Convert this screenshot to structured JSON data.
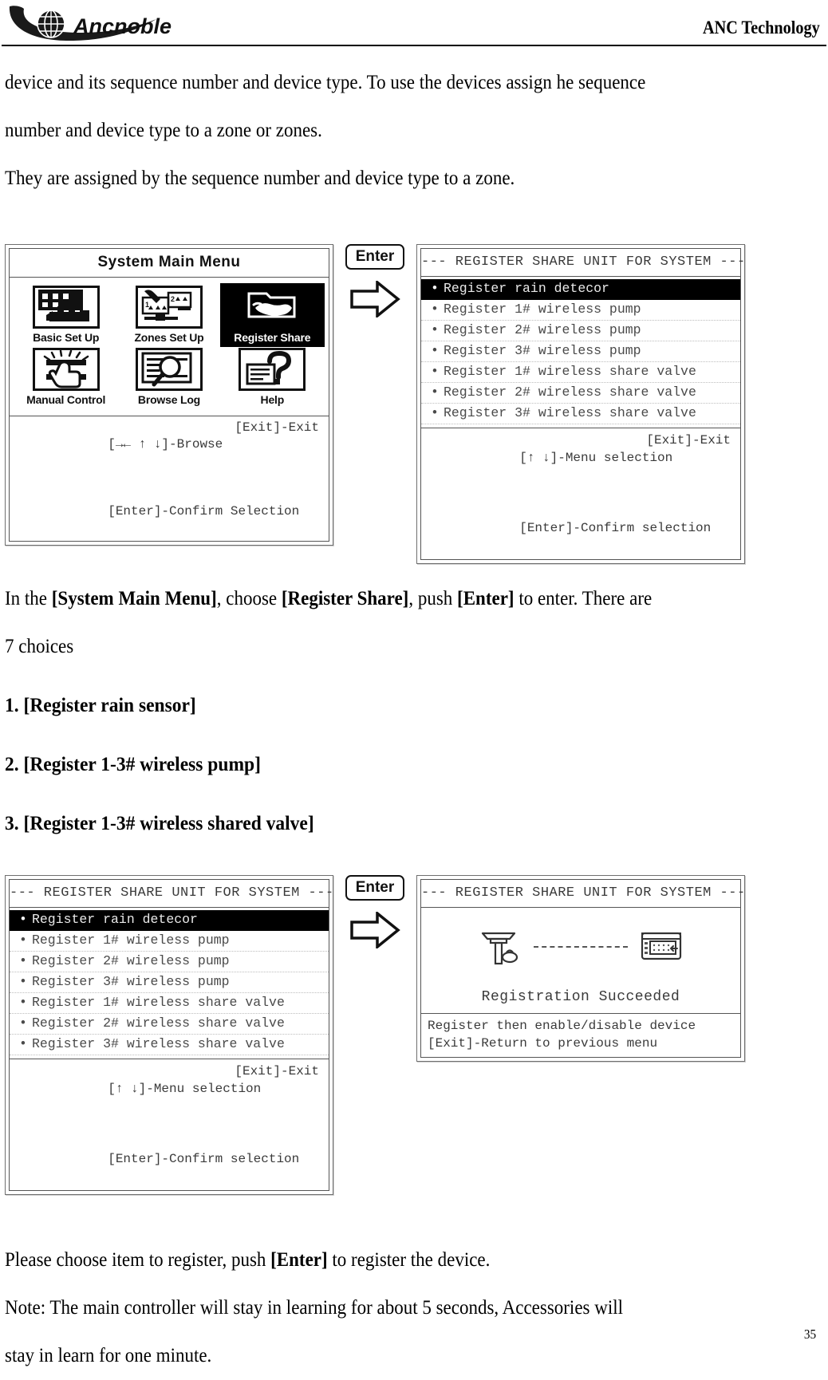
{
  "header": {
    "logo_text": "Ancnoble",
    "logo_icon": "globe-icon",
    "company": "ANC Technology"
  },
  "body": {
    "intro_paragraph_line1": "device and its sequence number and device type. To use the devices assign he sequence",
    "intro_paragraph_line2": "number and device type to a zone or zones.",
    "intro_paragraph_line3": "They are assigned by the sequence number and device type to a zone.",
    "instruction": {
      "p1": "In the ",
      "b1": "[System Main Menu]",
      "p2": ", choose ",
      "b2": "[Register Share]",
      "p3": ", push ",
      "b3": "[Enter]",
      "p4": " to enter. There are",
      "line2": "7 choices"
    },
    "choices": [
      {
        "num": "1.",
        "label": "[Register rain sensor]"
      },
      {
        "num": "2.",
        "label": "[Register 1-3# wireless pump]"
      },
      {
        "num": "3.",
        "label": "[Register 1-3# wireless shared valve]"
      }
    ],
    "closing": {
      "p1": "Please choose item to register, push ",
      "b1": "[Enter]",
      "p2": " to register the device.",
      "note_line1": "Note: The main controller will stay in learning for about 5 seconds, Accessories will",
      "note_line2": "stay in learn for one minute."
    },
    "page_number": "35"
  },
  "enter_key": {
    "label": "Enter",
    "arrow": "right-arrow-icon"
  },
  "panel_main_menu": {
    "title": "System Main Menu",
    "items": [
      {
        "label": "Basic Set Up",
        "icon": "controller-panel-icon",
        "selected": false
      },
      {
        "label": "Zones Set Up",
        "icon": "wrench-zones-icon",
        "selected": false
      },
      {
        "label": "Register Share",
        "icon": "hand-folder-icon",
        "selected": true
      },
      {
        "label": "Manual Control",
        "icon": "hand-press-icon",
        "selected": false
      },
      {
        "label": "Browse Log",
        "icon": "magnifier-log-icon",
        "selected": false
      },
      {
        "label": "Help",
        "icon": "question-mark-icon",
        "selected": false
      }
    ],
    "footer_left_1": "[→← ↑ ↓]-Browse",
    "footer_right_1": "[Exit]-Exit",
    "footer_left_2": "[Enter]-Confirm Selection"
  },
  "panel_register_list": {
    "title": "--- REGISTER SHARE UNIT FOR SYSTEM ---",
    "items": [
      {
        "label": "Register rain detecor",
        "selected": true
      },
      {
        "label": "Register 1# wireless pump",
        "selected": false
      },
      {
        "label": "Register 2# wireless pump",
        "selected": false
      },
      {
        "label": "Register 3# wireless pump",
        "selected": false
      },
      {
        "label": "Register 1# wireless share valve",
        "selected": false
      },
      {
        "label": "Register 2# wireless share valve",
        "selected": false
      },
      {
        "label": "Register 3# wireless share valve",
        "selected": false
      }
    ],
    "footer_left_1": "[↑ ↓]-Menu selection",
    "footer_right_1": "[Exit]-Exit",
    "footer_left_2": "[Enter]-Confirm selection"
  },
  "panel_register_list2": {
    "title": "--- REGISTER SHARE UNIT FOR SYSTEM ---",
    "items": [
      {
        "label": "Register rain detecor",
        "selected": true
      },
      {
        "label": "Register 1# wireless pump",
        "selected": false
      },
      {
        "label": "Register 2# wireless pump",
        "selected": false
      },
      {
        "label": "Register 3# wireless pump",
        "selected": false
      },
      {
        "label": "Register 1# wireless share valve",
        "selected": false
      },
      {
        "label": "Register 2# wireless share valve",
        "selected": false
      },
      {
        "label": "Register 3# wireless share valve",
        "selected": false
      }
    ],
    "footer_left_1": "[↑ ↓]-Menu selection",
    "footer_right_1": "[Exit]-Exit",
    "footer_left_2": "[Enter]-Confirm selection"
  },
  "panel_success": {
    "title": "--- REGISTER SHARE UNIT FOR SYSTEM ---",
    "device_icon": "rain-sensor-icon",
    "controller_icon": "controller-icon",
    "link_icon": "dashed-link-icon",
    "message": "Registration Succeeded",
    "footer_line_1": "Register then enable/disable device",
    "footer_line_2": "[Exit]-Return to previous menu"
  },
  "colors": {
    "ink": "#000000",
    "lcd_text": "#3a3a3a",
    "lcd_border": "#555555",
    "frame": "#6f6f6f"
  }
}
